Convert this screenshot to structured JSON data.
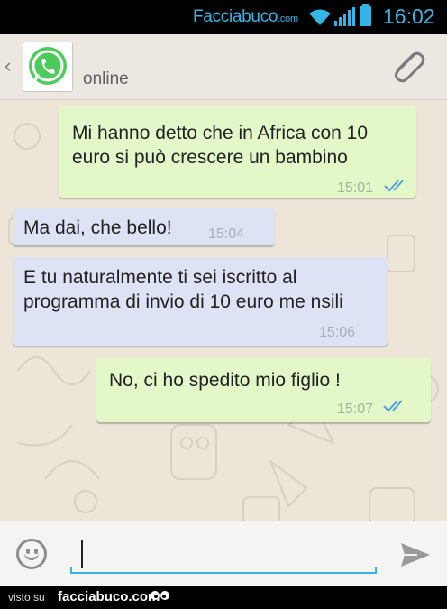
{
  "status_bar": {
    "brand": "Facciabuco",
    "brand_suffix": ".com",
    "time": "16:02",
    "accent": "#33b5e5"
  },
  "header": {
    "contact_status": "online",
    "avatar_icon": "whatsapp-logo-icon",
    "attach_icon": "paperclip-icon"
  },
  "messages": [
    {
      "direction": "outgoing",
      "text": "Mi hanno detto che in Africa con 10 euro si può crescere un bambino",
      "time": "15:01",
      "read": true
    },
    {
      "direction": "incoming",
      "text": "Ma dai, che bello!",
      "time": "15:04"
    },
    {
      "direction": "incoming",
      "text": "E tu naturalmente ti sei iscritto al programma di invio di 10 euro me nsili",
      "time": "15:06"
    },
    {
      "direction": "outgoing",
      "text": "No, ci ho spedito mio figlio !",
      "time": "15:07",
      "read": true
    }
  ],
  "composer": {
    "value": "",
    "emoji_icon": "smiley-icon",
    "send_icon": "send-icon"
  },
  "footer": {
    "visto_su": "visto su",
    "site": "facciabuco.com"
  },
  "colors": {
    "outgoing_bubble": "#e3f7c9",
    "incoming_bubble": "#dde2f5",
    "chat_background": "#ece5d8",
    "read_ticks": "#4fa3e0"
  }
}
